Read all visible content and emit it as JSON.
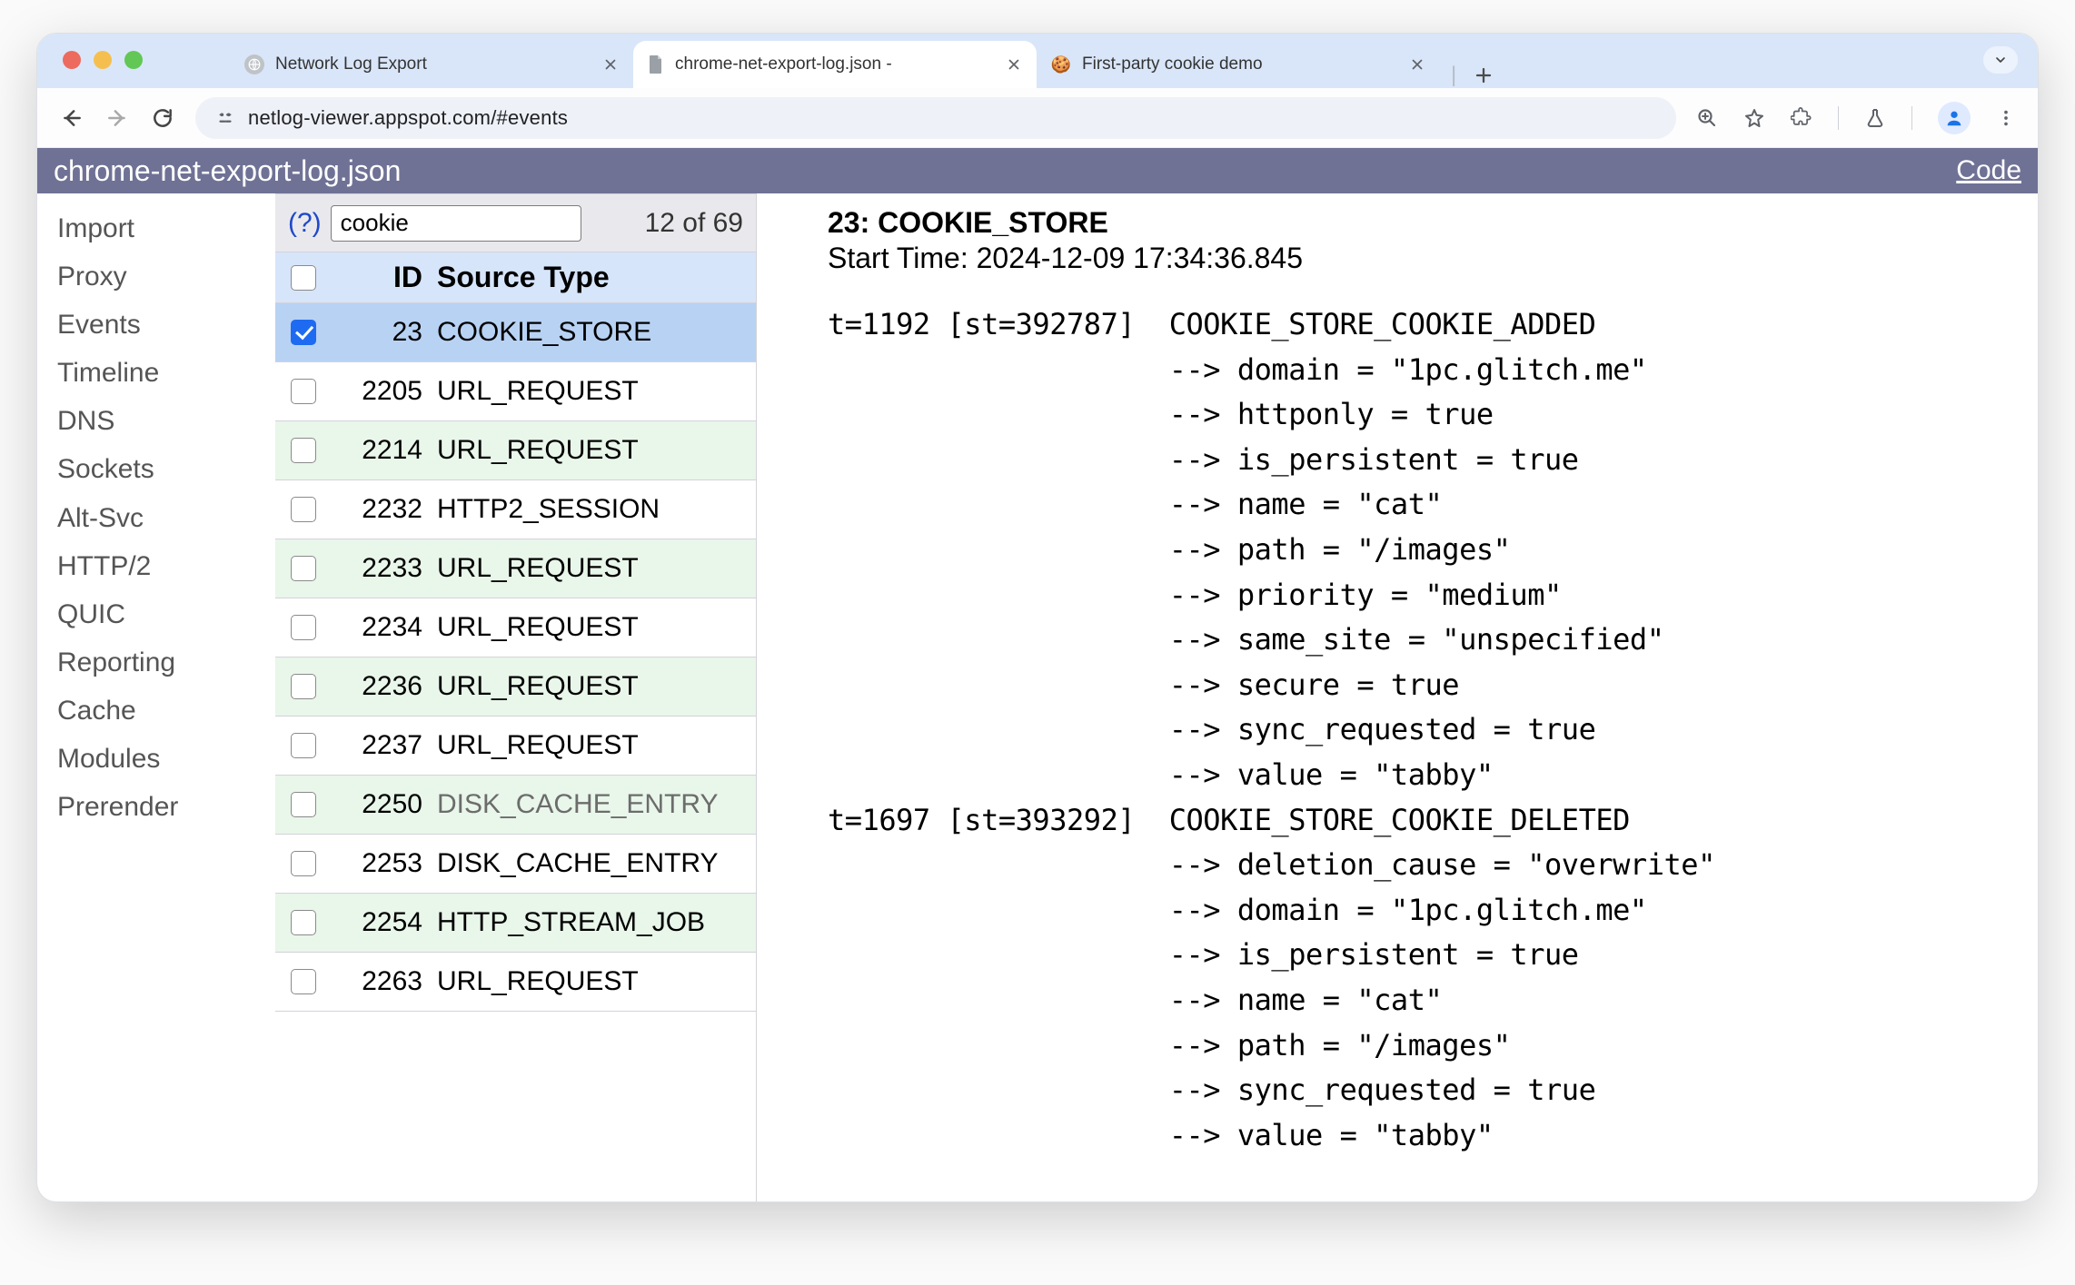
{
  "browser": {
    "tabs": [
      {
        "title": "Network Log Export",
        "favicon": "globe-gray"
      },
      {
        "title": "chrome-net-export-log.json - ",
        "favicon": "doc"
      },
      {
        "title": "First-party cookie demo",
        "favicon": "cookie"
      }
    ],
    "url": "netlog-viewer.appspot.com/#events"
  },
  "purple": {
    "title": "chrome-net-export-log.json",
    "code": "Code"
  },
  "sidenav": {
    "items": [
      "Import",
      "Proxy",
      "Events",
      "Timeline",
      "DNS",
      "Sockets",
      "Alt-Svc",
      "HTTP/2",
      "QUIC",
      "Reporting",
      "Cache",
      "Modules",
      "Prerender"
    ]
  },
  "filter": {
    "help": "(?)",
    "search": "cookie",
    "count": "12 of 69",
    "header_id": "ID",
    "header_source": "Source Type",
    "rows": [
      {
        "id": "23",
        "type": "COOKIE_STORE",
        "selected": true
      },
      {
        "id": "2205",
        "type": "URL_REQUEST"
      },
      {
        "id": "2214",
        "type": "URL_REQUEST"
      },
      {
        "id": "2232",
        "type": "HTTP2_SESSION"
      },
      {
        "id": "2233",
        "type": "URL_REQUEST"
      },
      {
        "id": "2234",
        "type": "URL_REQUEST"
      },
      {
        "id": "2236",
        "type": "URL_REQUEST"
      },
      {
        "id": "2237",
        "type": "URL_REQUEST"
      },
      {
        "id": "2250",
        "type": "DISK_CACHE_ENTRY",
        "dim": true
      },
      {
        "id": "2253",
        "type": "DISK_CACHE_ENTRY",
        "dim": true
      },
      {
        "id": "2254",
        "type": "HTTP_STREAM_JOB"
      },
      {
        "id": "2263",
        "type": "URL_REQUEST"
      }
    ]
  },
  "detail": {
    "title": "23: COOKIE_STORE",
    "start": "Start Time: 2024-12-09 17:34:36.845",
    "log": "t=1192 [st=392787]  COOKIE_STORE_COOKIE_ADDED\n                    --> domain = \"1pc.glitch.me\"\n                    --> httponly = true\n                    --> is_persistent = true\n                    --> name = \"cat\"\n                    --> path = \"/images\"\n                    --> priority = \"medium\"\n                    --> same_site = \"unspecified\"\n                    --> secure = true\n                    --> sync_requested = true\n                    --> value = \"tabby\"\nt=1697 [st=393292]  COOKIE_STORE_COOKIE_DELETED\n                    --> deletion_cause = \"overwrite\"\n                    --> domain = \"1pc.glitch.me\"\n                    --> is_persistent = true\n                    --> name = \"cat\"\n                    --> path = \"/images\"\n                    --> sync_requested = true\n                    --> value = \"tabby\""
  }
}
